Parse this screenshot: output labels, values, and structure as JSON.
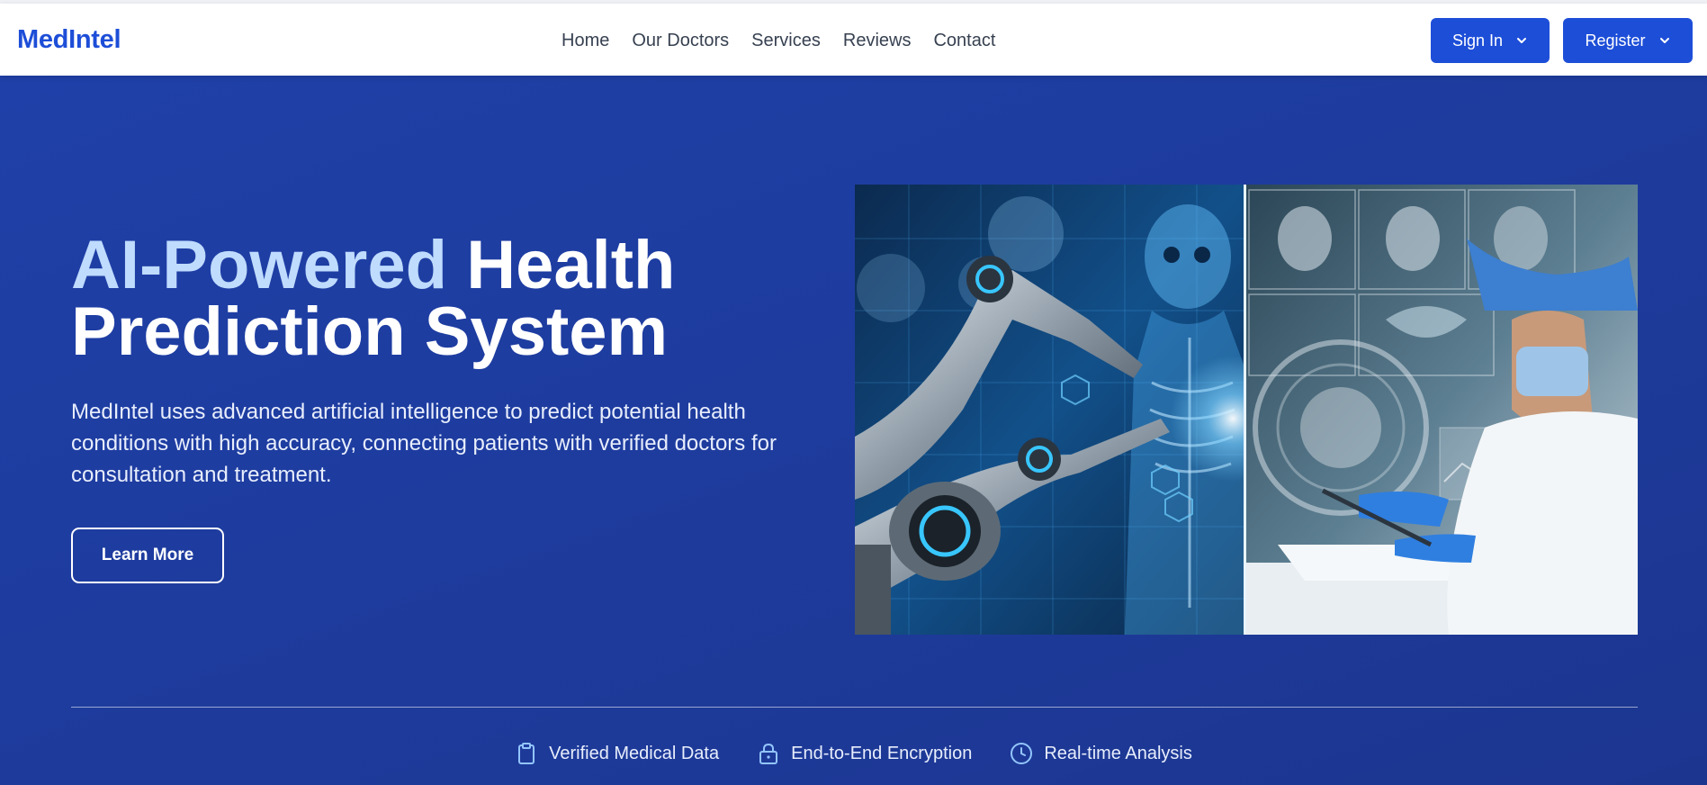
{
  "nav": {
    "brand": "MedIntel",
    "links": [
      "Home",
      "Our Doctors",
      "Services",
      "Reviews",
      "Contact"
    ],
    "signin_label": "Sign In",
    "register_label": "Register"
  },
  "hero": {
    "title_accent": "AI-Powered",
    "title_rest_line1": "Health",
    "title_line2": "Prediction System",
    "description": "MedIntel uses advanced artificial intelligence to predict potential health conditions with high accuracy, connecting patients with verified doctors for consultation and treatment.",
    "cta_label": "Learn More"
  },
  "features": [
    {
      "icon": "clipboard-icon",
      "label": "Verified Medical Data"
    },
    {
      "icon": "lock-icon",
      "label": "End-to-End Encryption"
    },
    {
      "icon": "clock-icon",
      "label": "Real-time Analysis"
    }
  ],
  "colors": {
    "primary": "#1d4ed8",
    "hero_bg": "#1e3c9e",
    "accent_text": "#bfdbfe"
  }
}
